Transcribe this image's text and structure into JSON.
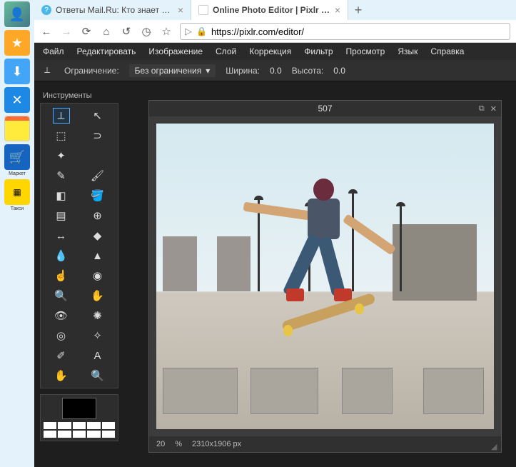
{
  "os_sidebar": {
    "items": [
      "avatar",
      "star",
      "download",
      "tools",
      "notes",
      "shop",
      "taxi"
    ],
    "shop_label": "Маркет",
    "taxi_label": "Такси"
  },
  "browser": {
    "tabs": [
      {
        "title": "Ответы Mail.Ru: Кто знает таку...",
        "favicon_color": "#4db8e8",
        "active": false
      },
      {
        "title": "Online Photo Editor | Pixlr Editor | ...",
        "favicon_color": "#fff",
        "active": true
      }
    ],
    "url": "https://pixlr.com/editor/"
  },
  "app": {
    "menu": [
      "Файл",
      "Редактировать",
      "Изображение",
      "Слой",
      "Коррекция",
      "Фильтр",
      "Просмотр",
      "Язык",
      "Справка"
    ],
    "options_bar": {
      "constraint_label": "Ограничение:",
      "constraint_value": "Без ограничения",
      "width_label": "Ширина:",
      "width_value": "0.0",
      "height_label": "Высота:",
      "height_value": "0.0"
    },
    "tool_panel": {
      "title": "Инструменты",
      "selected_index": 0
    },
    "canvas": {
      "title": "507",
      "zoom": "20",
      "zoom_unit": "%",
      "dimensions": "2310x1906 px"
    }
  }
}
